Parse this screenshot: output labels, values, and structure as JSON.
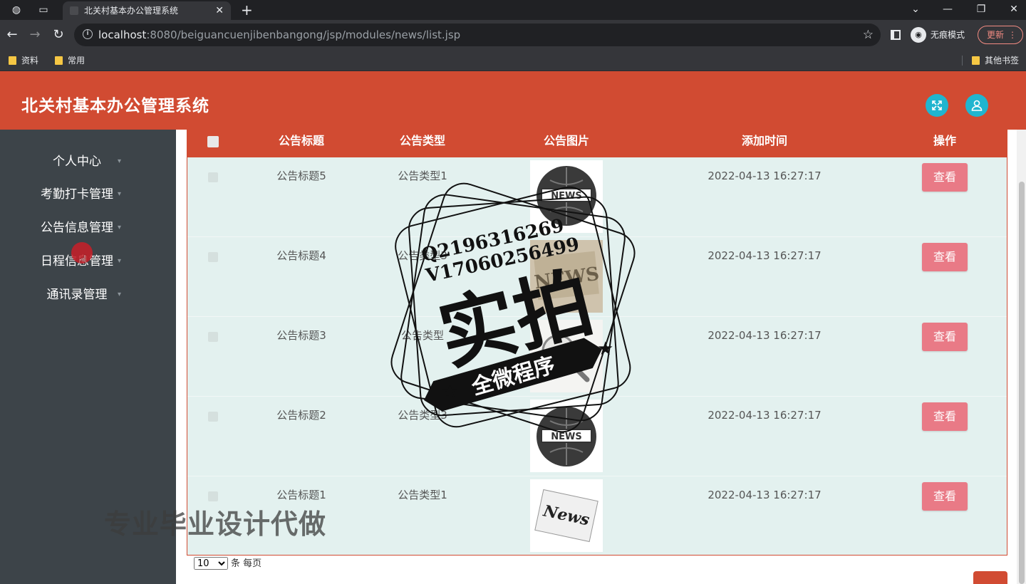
{
  "browser": {
    "tab_title": "北关村基本办公管理系统",
    "url_host": "localhost",
    "url_rest": ":8080/beiguancuenjibenbangong/jsp/modules/news/list.jsp",
    "incognito_label": "无痕模式",
    "update_label": "更新",
    "bookmarks": [
      "资料",
      "常用"
    ],
    "other_bookmarks": "其他书签"
  },
  "header": {
    "title": "北关村基本办公管理系统",
    "fullscreen_icon": "expand-icon",
    "user_icon": "user-icon"
  },
  "sidebar": {
    "items": [
      {
        "label": "个人中心"
      },
      {
        "label": "考勤打卡管理"
      },
      {
        "label": "公告信息管理"
      },
      {
        "label": "日程信息管理"
      },
      {
        "label": "通讯录管理"
      }
    ]
  },
  "table": {
    "columns": [
      "公告标题",
      "公告类型",
      "公告图片",
      "添加时间",
      "操作"
    ],
    "rows": [
      {
        "title": "公告标题5",
        "type": "公告类型1",
        "image": "news-globe",
        "time": "2022-04-13 16:27:17",
        "action": "查看"
      },
      {
        "title": "公告标题4",
        "type": "公告类型3",
        "image": "news-paper",
        "time": "2022-04-13 16:27:17",
        "action": "查看"
      },
      {
        "title": "公告标题3",
        "type": "公告类型",
        "image": "news-magnifier",
        "time": "2022-04-13 16:27:17",
        "action": "查看"
      },
      {
        "title": "公告标题2",
        "type": "公告类型3",
        "image": "news-globe",
        "time": "2022-04-13 16:27:17",
        "action": "查看"
      },
      {
        "title": "公告标题1",
        "type": "公告类型1",
        "image": "news-tilted",
        "time": "2022-04-13 16:27:17",
        "action": "查看"
      }
    ]
  },
  "pager": {
    "page_size": "10",
    "suffix": "条 每页"
  },
  "watermark": {
    "qq": "Q2196316269",
    "vx": "V17060256499",
    "big": "实拍",
    "banner": "全微程序",
    "bottom": "专业毕业设计代做"
  }
}
